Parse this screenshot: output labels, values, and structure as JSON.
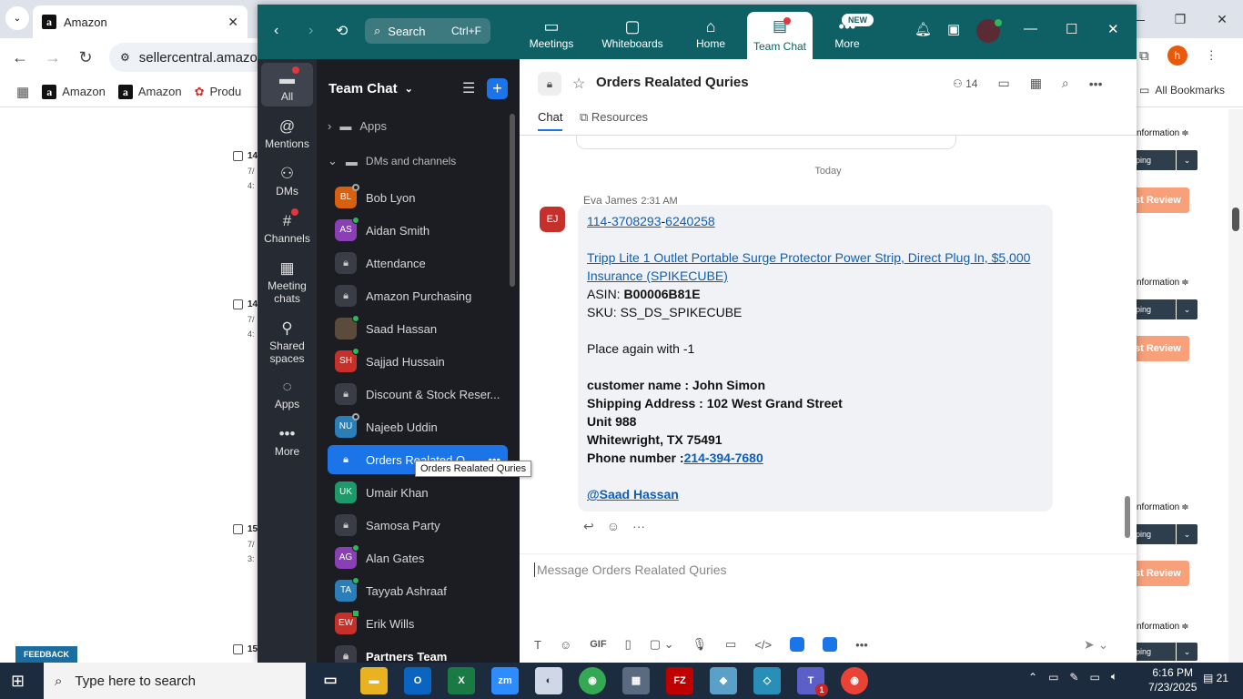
{
  "browser": {
    "tab_title": "Amazon",
    "url": "sellercentral.amazon",
    "bookmarks": [
      "Amazon",
      "Amazon",
      "Produ"
    ],
    "all_bookmarks": "All Bookmarks",
    "profile_initial": "h"
  },
  "background_page": {
    "rows": [
      {
        "num": "14",
        "line2": "7/",
        "line3": "4:"
      },
      {
        "num": "14",
        "line2": "7/",
        "line3": "4:"
      },
      {
        "num": "15",
        "line2": "7/",
        "line3": "3:"
      },
      {
        "num": "15",
        "line2": "7/"
      }
    ],
    "info_label": "nformation",
    "dropdown_label": "ping",
    "review_label": "st Review",
    "feedback": "FEEDBACK"
  },
  "zoom": {
    "search_label": "Search",
    "search_shortcut": "Ctrl+F",
    "top_tabs": [
      {
        "label": "Meetings",
        "icon": "camera-icon"
      },
      {
        "label": "Whiteboards",
        "icon": "whiteboard-icon"
      },
      {
        "label": "Home",
        "icon": "home-icon"
      },
      {
        "label": "Team Chat",
        "icon": "chat-icon"
      },
      {
        "label": "More",
        "icon": "more-icon"
      }
    ],
    "new_badge": "NEW",
    "sidebar": [
      {
        "label": "All"
      },
      {
        "label": "Mentions"
      },
      {
        "label": "DMs"
      },
      {
        "label": "Channels"
      },
      {
        "label": "Meeting chats"
      },
      {
        "label": "Shared spaces"
      },
      {
        "label": "Apps"
      },
      {
        "label": "More"
      }
    ],
    "panel": {
      "title": "Team Chat",
      "sections": [
        "Apps",
        "DMs and channels"
      ],
      "items": [
        {
          "name": "Bob Lyon",
          "initials": "BL",
          "color": "#d9600f",
          "status": "off"
        },
        {
          "name": "Aidan Smith",
          "initials": "AS",
          "color": "#8a3fb5",
          "status": "on"
        },
        {
          "name": "Attendance",
          "lock": true
        },
        {
          "name": "Amazon Purchasing",
          "lock": true
        },
        {
          "name": "Saad Hassan",
          "initials": "",
          "color": "#5b4b3a",
          "status": "on"
        },
        {
          "name": "Sajjad Hussain",
          "initials": "SH",
          "color": "#c5302a",
          "status": "on"
        },
        {
          "name": "Discount & Stock Reser...",
          "lock": true
        },
        {
          "name": "Najeeb Uddin",
          "initials": "NU",
          "color": "#2b7fb8",
          "status": "off"
        },
        {
          "name": "Orders Realated Q...",
          "lock": true,
          "active": true
        },
        {
          "name": "Umair Khan",
          "initials": "UK",
          "color": "#1e9a6a",
          "status": "none"
        },
        {
          "name": "Samosa Party",
          "lock": true
        },
        {
          "name": "Alan Gates",
          "initials": "AG",
          "color": "#8a3fb5",
          "status": "on"
        },
        {
          "name": "Tayyab Ashraaf",
          "initials": "TA",
          "color": "#2b7fb8",
          "status": "on"
        },
        {
          "name": "Erik Wills",
          "initials": "EW",
          "color": "#c5302a",
          "status": "mobile"
        },
        {
          "name": "Partners Team",
          "lock": true,
          "bold": true
        }
      ],
      "tooltip": "Orders Realated Quries"
    },
    "channel": {
      "name": "Orders Realated Quries",
      "member_count": "14",
      "tabs": [
        "Chat",
        "Resources"
      ],
      "date_divider": "Today",
      "message": {
        "sender": "Eva James",
        "time": "2:31 AM",
        "initials": "EJ",
        "order_part1": "114-3708293",
        "order_sep": "-",
        "order_part2": "6240258",
        "product_link": "Tripp Lite 1 Outlet Portable Surge Protector Power Strip, Direct Plug In, $5,000 Insurance (SPIKECUBE)",
        "asin_label": "ASIN: ",
        "asin": "B00006B81E",
        "sku": "SKU: SS_DS_SPIKECUBE",
        "note": "Place again with -1",
        "customer": "customer name : John Simon",
        "address1": "Shipping Address : 102 West Grand Street",
        "address2": "Unit 988",
        "address3": "Whitewright, TX 75491",
        "phone_label": "Phone number :",
        "phone": "214-394-7680",
        "mention": "@Saad Hassan"
      },
      "compose_placeholder": "Message Orders Realated Quries",
      "compose_tools": [
        "T",
        "☺",
        "GIF"
      ]
    }
  },
  "taskbar": {
    "search_placeholder": "Type here to search",
    "time": "6:16 PM",
    "date": "7/23/2025",
    "notifications": "21",
    "teams_badge": "1"
  }
}
